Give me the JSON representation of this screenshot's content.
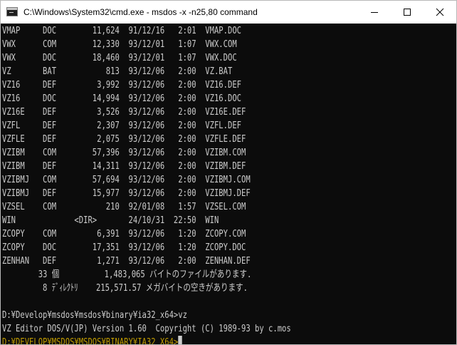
{
  "window": {
    "title": "C:\\Windows\\System32\\cmd.exe - msdos  -x -n25,80 command",
    "icon": "console-app-icon",
    "controls": {
      "minimize": "minimize-icon",
      "maximize": "maximize-icon",
      "close": "close-icon"
    }
  },
  "colors": {
    "console_background": "#0c0c0c",
    "console_text": "#cccccc",
    "prompt_yellow": "#c19c00",
    "titlebar_background": "#ffffff"
  },
  "console": {
    "listing": [
      "VMAP     DOC        11,624  91/12/16   2:01  VMAP.DOC",
      "VWX      COM        12,330  93/12/01   1:07  VWX.COM",
      "VWX      DOC        18,460  93/12/01   1:07  VWX.DOC",
      "VZ       BAT           813  93/12/06   2:00  VZ.BAT",
      "VZ16     DEF         3,992  93/12/06   2:00  VZ16.DEF",
      "VZ16     DOC        14,994  93/12/06   2:00  VZ16.DOC",
      "VZ16E    DEF         3,526  93/12/06   2:00  VZ16E.DEF",
      "VZFL     DEF         2,307  93/12/06   2:00  VZFL.DEF",
      "VZFLE    DEF         2,075  93/12/06   2:00  VZFLE.DEF",
      "VZIBM    COM        57,396  93/12/06   2:00  VZIBM.COM",
      "VZIBM    DEF        14,311  93/12/06   2:00  VZIBM.DEF",
      "VZIBMJ   COM        57,694  93/12/06   2:00  VZIBMJ.COM",
      "VZIBMJ   DEF        15,977  93/12/06   2:00  VZIBMJ.DEF",
      "VZSEL    COM           210  92/01/08   1:57  VZSEL.COM",
      "WIN             <DIR>       24/10/31  22:50  WIN",
      "ZCOPY    COM         6,391  93/12/06   1:20  ZCOPY.COM",
      "ZCOPY    DOC        17,351  93/12/06   1:20  ZCOPY.DOC",
      "ZENHAN   DEF         1,271  93/12/06   2:00  ZENHAN.DEF"
    ],
    "summary_files": "        33 個          1,483,065 バイトのファイルがあります.",
    "summary_dirs": "         8 ﾃﾞｨﾚｸﾄﾘ    215,571.57 メガバイトの空きがあります.",
    "blank": "",
    "command": "D:¥Develop¥msdos¥msdos¥binary¥ia32_x64>vz",
    "vz_banner": "VZ Editor DOS/V(JP) Version 1.60  Copyright (C) 1989-93 by c.mos",
    "prompt": "D:¥DEVELOP¥MSDOS¥MSDOS¥BINARY¥IA32_X64>"
  }
}
